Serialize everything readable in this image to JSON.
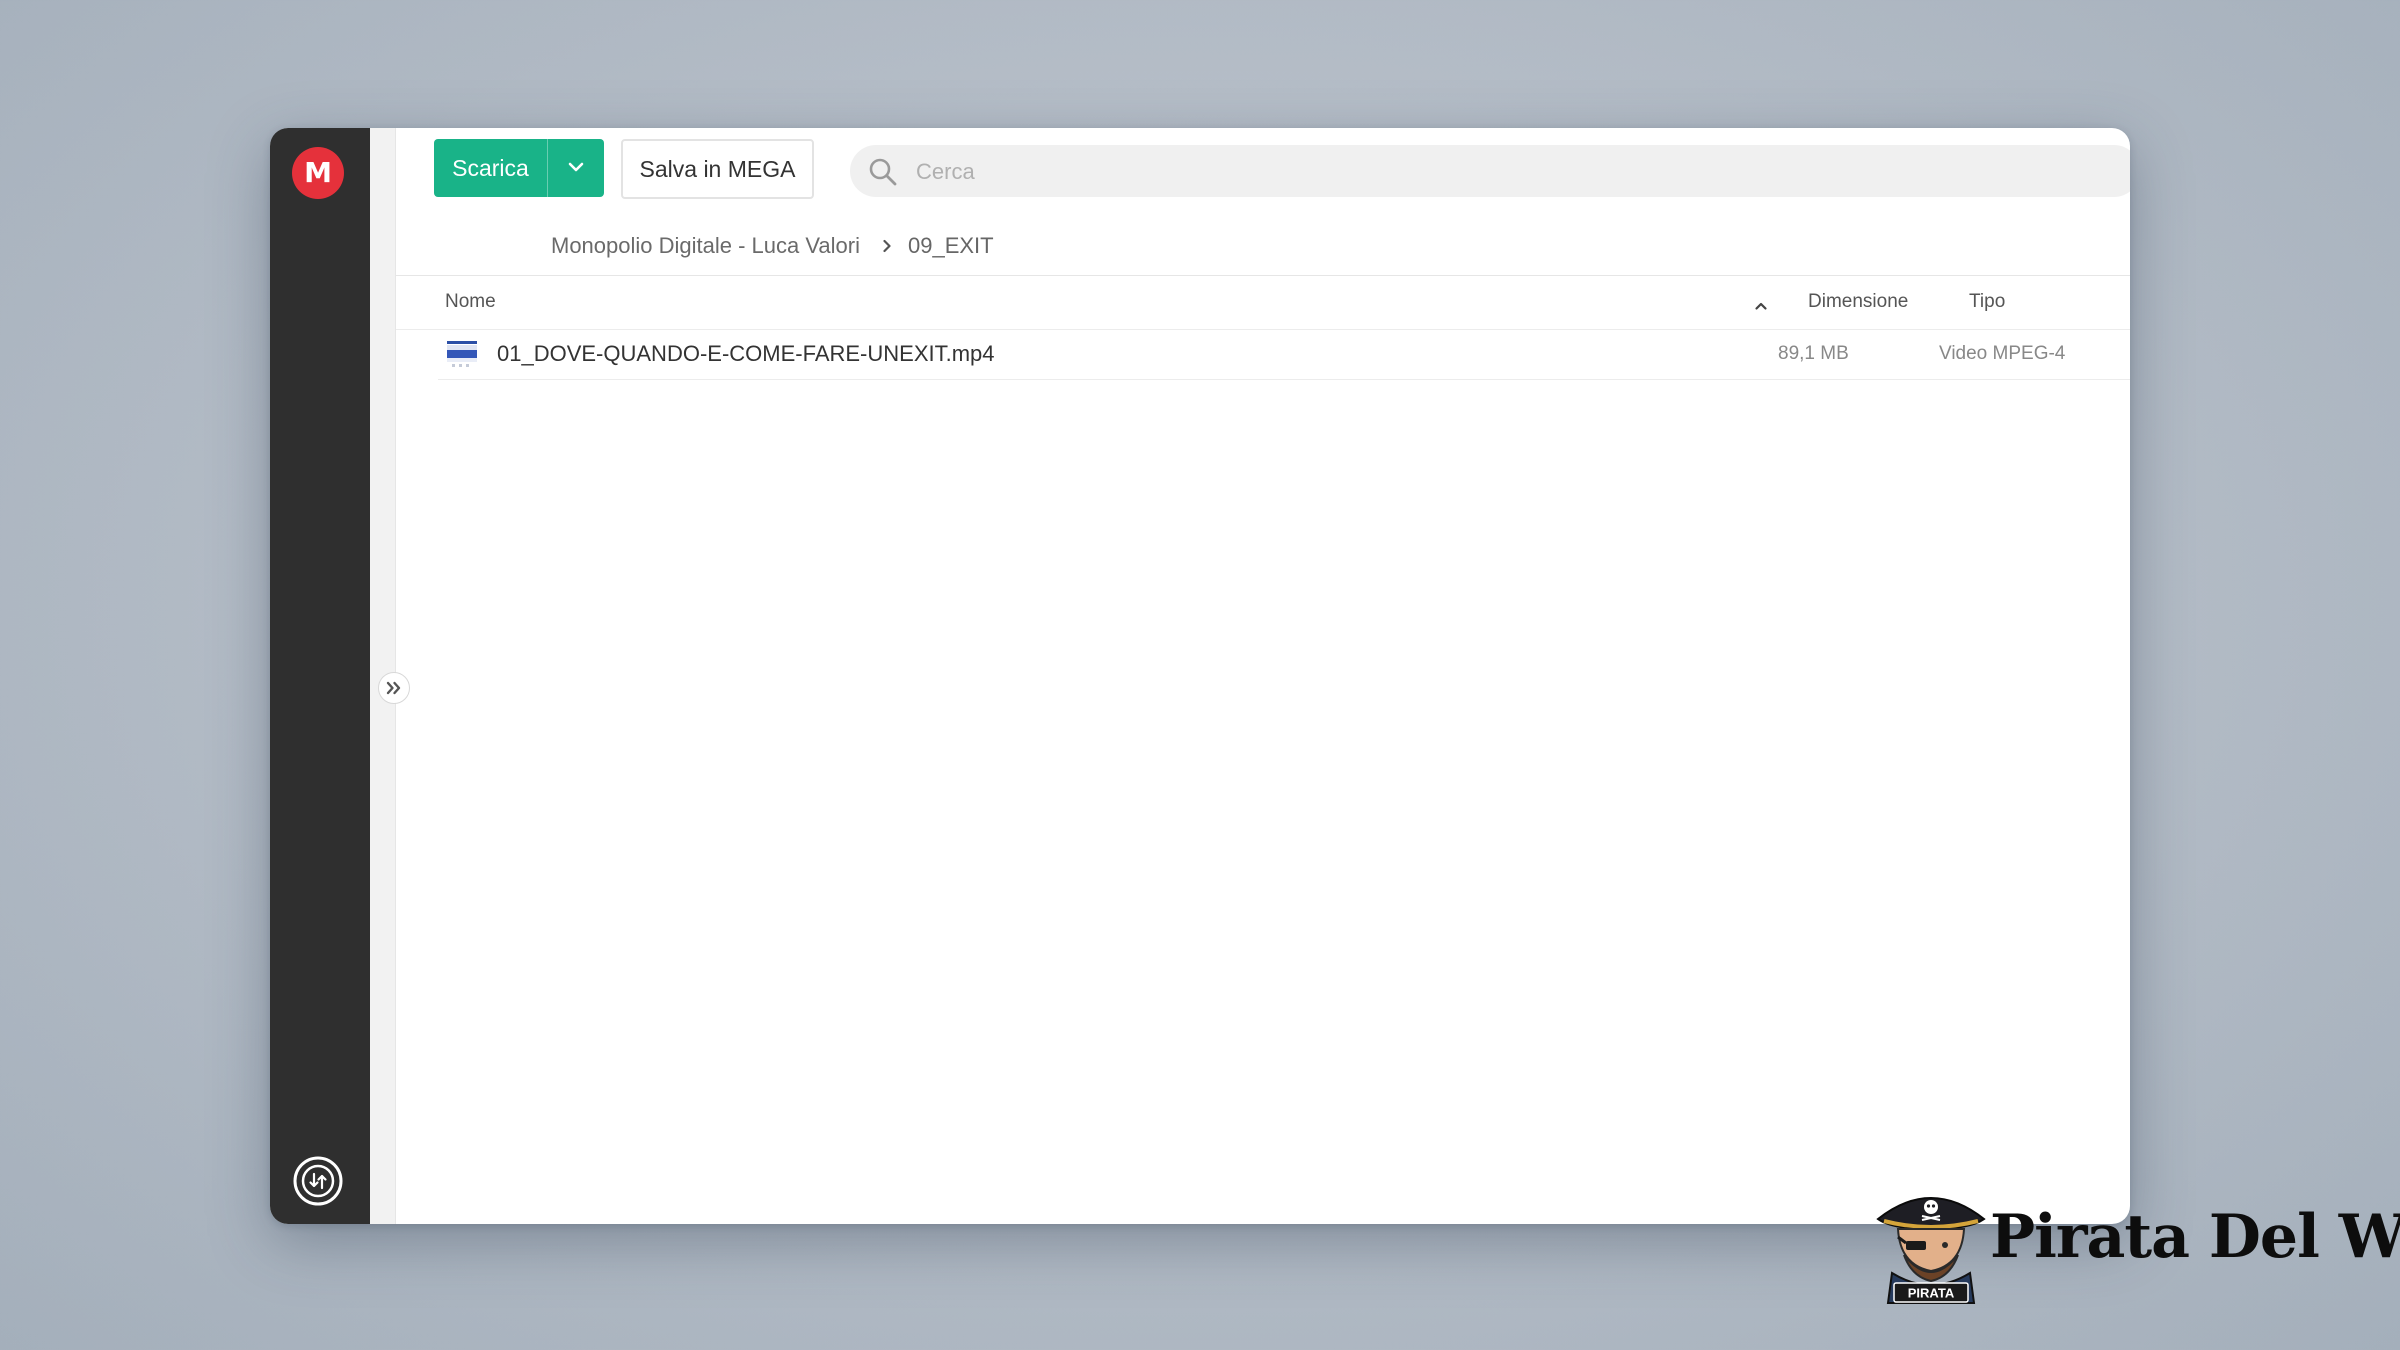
{
  "sidebar": {
    "logo_letter": "M",
    "logo_color": "#e5313b",
    "transfer_icon": "transfer-manager-icon",
    "expand_icon": "double-chevron-right-icon"
  },
  "toolbar": {
    "download_label": "Scarica",
    "download_color": "#19b388",
    "download_menu_icon": "chevron-down-icon",
    "save_label": "Salva in MEGA"
  },
  "search": {
    "placeholder": "Cerca",
    "value": "",
    "icon": "search-icon"
  },
  "breadcrumb": {
    "items": [
      "Monopolio Digitale - Luca Valori",
      "09_EXIT"
    ],
    "separator_icon": "chevron-right-icon"
  },
  "table": {
    "columns": {
      "name": "Nome",
      "size": "Dimensione",
      "type": "Tipo"
    },
    "sort_icon": "chevron-up-icon",
    "rows": [
      {
        "name": "01_DOVE-QUANDO-E-COME-FARE-UNEXIT.mp4",
        "size": "89,1 MB",
        "type": "Video MPEG-4",
        "icon": "video-file-icon"
      }
    ]
  },
  "watermark": {
    "text": "Pirata Del Web",
    "badge": "PIRATA"
  }
}
